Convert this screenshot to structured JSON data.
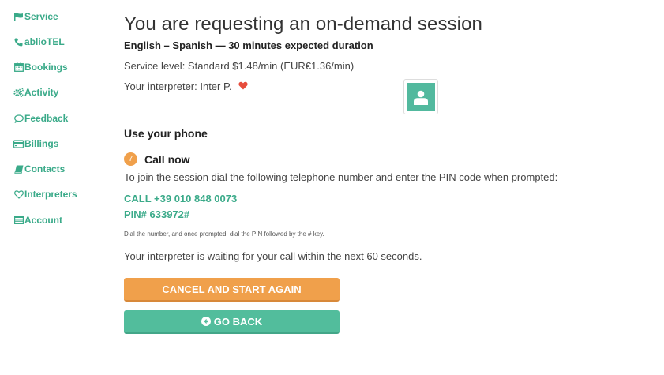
{
  "sidebar": {
    "items": [
      {
        "label": "Service",
        "icon": "flag-icon"
      },
      {
        "label": "ablioTEL",
        "icon": "phone-icon"
      },
      {
        "label": "Bookings",
        "icon": "calendar-icon"
      },
      {
        "label": "Activity",
        "icon": "gears-icon"
      },
      {
        "label": "Feedback",
        "icon": "comment-icon"
      },
      {
        "label": "Billings",
        "icon": "credit-card-icon"
      },
      {
        "label": "Contacts",
        "icon": "book-icon"
      },
      {
        "label": "Interpreters",
        "icon": "heart-outline-icon"
      },
      {
        "label": "Account",
        "icon": "list-icon"
      }
    ]
  },
  "main": {
    "title": "You are requesting an on-demand session",
    "subtitle": "English – Spanish — 30 minutes expected duration",
    "service_level": "Service level: Standard $1.48/min (EUR€1.36/min)",
    "interpreter": "Your interpreter: Inter P.",
    "section_title": "Use your phone",
    "step_number": "7",
    "step_title": "Call now",
    "instructions": "To join the session dial the following telephone number and enter the PIN code when prompted:",
    "call": "CALL +39 010 848 0073",
    "pin": "PIN# 633972#",
    "hint": "Dial the number, and once prompted, dial the PIN followed by the # key.",
    "waiting": "Your interpreter is waiting for your call within the next 60 seconds.",
    "cancel_label": "CANCEL AND START AGAIN",
    "back_label": "GO BACK"
  },
  "colors": {
    "accent_green": "#3aaa89",
    "button_orange": "#f0a04b",
    "button_green": "#52bd9c",
    "heart_red": "#e74c3c"
  }
}
